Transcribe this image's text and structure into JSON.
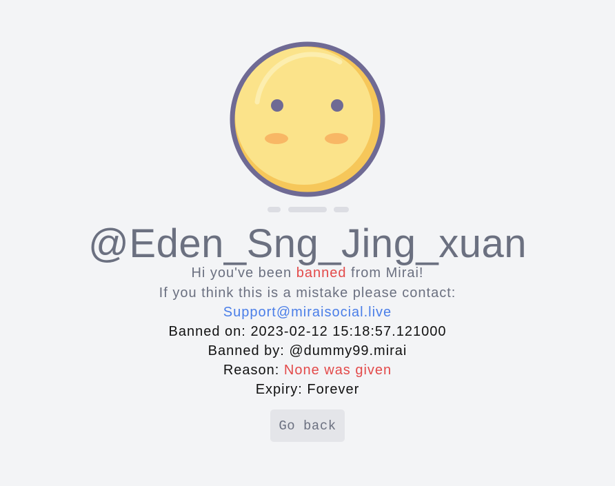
{
  "user": {
    "handle": "@Eden_Sng_Jing_xuan"
  },
  "message": {
    "greeting_prefix": "Hi you've been",
    "greeting_status": "banned",
    "greeting_suffix": "from Mirai!",
    "contact_line": "If you think this is a mistake please contact:",
    "support_email": "Support@miraisocial.live"
  },
  "ban": {
    "banned_on_label": "Banned on:",
    "banned_on_value": "2023-02-12 15:18:57.121000",
    "banned_by_label": "Banned by:",
    "banned_by_value": "@dummy99.mirai",
    "reason_label": "Reason:",
    "reason_value": "None was given",
    "expiry_label": "Expiry:",
    "expiry_value": "Forever"
  },
  "actions": {
    "go_back_label": "Go back"
  },
  "colors": {
    "background": "#f3f4f6",
    "text_muted": "#6b7080",
    "accent_red": "#e34a4a",
    "link_blue": "#4a7ee8",
    "face_fill": "#fbe38a",
    "face_outline": "#6f6a94"
  },
  "icons": {
    "illustration": "sad-face-icon"
  }
}
